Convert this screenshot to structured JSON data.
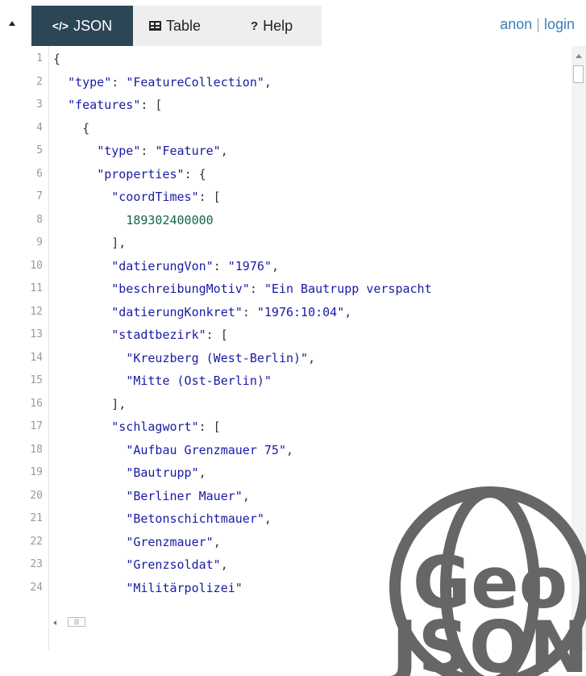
{
  "header": {
    "tabs": [
      {
        "label": "JSON",
        "icon": "code-icon"
      },
      {
        "label": "Table",
        "icon": "table-icon"
      },
      {
        "label": "Help",
        "icon": "question-icon"
      }
    ],
    "auth": {
      "anon": "anon",
      "separator": "|",
      "login": "login"
    }
  },
  "editor": {
    "lines": [
      {
        "num": "1",
        "parts": [
          [
            "p",
            "{"
          ]
        ]
      },
      {
        "num": "2",
        "parts": [
          [
            "p",
            "  "
          ],
          [
            "k",
            "\"type\""
          ],
          [
            "p",
            ": "
          ],
          [
            "s",
            "\"FeatureCollection\""
          ],
          [
            "p",
            ","
          ]
        ]
      },
      {
        "num": "3",
        "parts": [
          [
            "p",
            "  "
          ],
          [
            "k",
            "\"features\""
          ],
          [
            "p",
            ": ["
          ]
        ]
      },
      {
        "num": "4",
        "parts": [
          [
            "p",
            "    {"
          ]
        ]
      },
      {
        "num": "5",
        "parts": [
          [
            "p",
            "      "
          ],
          [
            "k",
            "\"type\""
          ],
          [
            "p",
            ": "
          ],
          [
            "s",
            "\"Feature\""
          ],
          [
            "p",
            ","
          ]
        ]
      },
      {
        "num": "6",
        "parts": [
          [
            "p",
            "      "
          ],
          [
            "k",
            "\"properties\""
          ],
          [
            "p",
            ": {"
          ]
        ]
      },
      {
        "num": "7",
        "parts": [
          [
            "p",
            "        "
          ],
          [
            "k",
            "\"coordTimes\""
          ],
          [
            "p",
            ": ["
          ]
        ]
      },
      {
        "num": "8",
        "parts": [
          [
            "p",
            "          "
          ],
          [
            "n",
            "189302400000"
          ]
        ]
      },
      {
        "num": "9",
        "parts": [
          [
            "p",
            "        ],"
          ]
        ]
      },
      {
        "num": "10",
        "parts": [
          [
            "p",
            "        "
          ],
          [
            "k",
            "\"datierungVon\""
          ],
          [
            "p",
            ": "
          ],
          [
            "s",
            "\"1976\""
          ],
          [
            "p",
            ","
          ]
        ]
      },
      {
        "num": "11",
        "parts": [
          [
            "p",
            "        "
          ],
          [
            "k",
            "\"beschreibungMotiv\""
          ],
          [
            "p",
            ": "
          ],
          [
            "s",
            "\"Ein Bautrupp verspacht"
          ]
        ]
      },
      {
        "num": "12",
        "parts": [
          [
            "p",
            "        "
          ],
          [
            "k",
            "\"datierungKonkret\""
          ],
          [
            "p",
            ": "
          ],
          [
            "s",
            "\"1976:10:04\""
          ],
          [
            "p",
            ","
          ]
        ]
      },
      {
        "num": "13",
        "parts": [
          [
            "p",
            "        "
          ],
          [
            "k",
            "\"stadtbezirk\""
          ],
          [
            "p",
            ": ["
          ]
        ]
      },
      {
        "num": "14",
        "parts": [
          [
            "p",
            "          "
          ],
          [
            "s",
            "\"Kreuzberg (West-Berlin)\""
          ],
          [
            "p",
            ","
          ]
        ]
      },
      {
        "num": "15",
        "parts": [
          [
            "p",
            "          "
          ],
          [
            "s",
            "\"Mitte (Ost-Berlin)\""
          ]
        ]
      },
      {
        "num": "16",
        "parts": [
          [
            "p",
            "        ],"
          ]
        ]
      },
      {
        "num": "17",
        "parts": [
          [
            "p",
            "        "
          ],
          [
            "k",
            "\"schlagwort\""
          ],
          [
            "p",
            ": ["
          ]
        ]
      },
      {
        "num": "18",
        "parts": [
          [
            "p",
            "          "
          ],
          [
            "s",
            "\"Aufbau Grenzmauer 75\""
          ],
          [
            "p",
            ","
          ]
        ]
      },
      {
        "num": "19",
        "parts": [
          [
            "p",
            "          "
          ],
          [
            "s",
            "\"Bautrupp\""
          ],
          [
            "p",
            ","
          ]
        ]
      },
      {
        "num": "20",
        "parts": [
          [
            "p",
            "          "
          ],
          [
            "s",
            "\"Berliner Mauer\""
          ],
          [
            "p",
            ","
          ]
        ]
      },
      {
        "num": "21",
        "parts": [
          [
            "p",
            "          "
          ],
          [
            "s",
            "\"Betonschichtmauer\""
          ],
          [
            "p",
            ","
          ]
        ]
      },
      {
        "num": "22",
        "parts": [
          [
            "p",
            "          "
          ],
          [
            "s",
            "\"Grenzmauer\""
          ],
          [
            "p",
            ","
          ]
        ]
      },
      {
        "num": "23",
        "parts": [
          [
            "p",
            "          "
          ],
          [
            "s",
            "\"Grenzsoldat\""
          ],
          [
            "p",
            ","
          ]
        ]
      },
      {
        "num": "24",
        "parts": [
          [
            "p",
            "          "
          ],
          [
            "s",
            "\"Militärpolizei\""
          ]
        ]
      }
    ]
  },
  "watermark": {
    "line1": "Geo",
    "line2": "JSON"
  },
  "colors": {
    "active_tab": "#2d4656",
    "tab_bar": "#eeeeee",
    "link": "#3a7fb8",
    "key": "#1a1aa6",
    "number": "#116644",
    "logo": "#666666"
  }
}
